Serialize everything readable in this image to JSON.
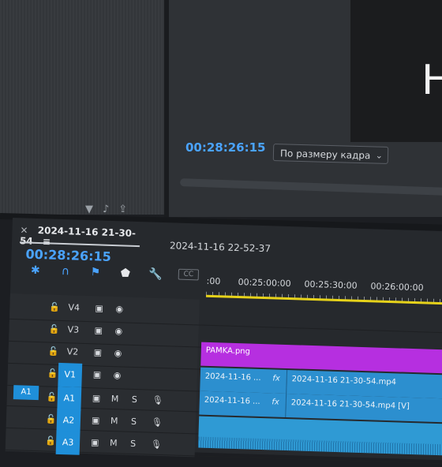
{
  "source_panel": {
    "icons": [
      "filter-icon",
      "music-icon",
      "export-icon"
    ]
  },
  "program": {
    "timecode": "00:28:26:15",
    "fit_dropdown": "По размеру кадра",
    "video_letter": "Н"
  },
  "timeline": {
    "tab_active": "2024-11-16 21-30-54",
    "tab_inactive": "2024-11-16 22-52-37",
    "timecode": "00:28:26:15",
    "ruler": [
      ":00",
      "00:25:00:00",
      "00:25:30:00",
      "00:26:00:00"
    ],
    "tools": [
      "snap-icon",
      "magnet-icon",
      "marker-icon",
      "marker-add-icon",
      "wrench-icon",
      "captions-icon"
    ],
    "tracks": {
      "v4": "V4",
      "v3": "V3",
      "v2": "V2",
      "v1": "V1",
      "a1_src": "A1",
      "a1": "A1",
      "a2": "A2",
      "a3": "A3",
      "mute": "M",
      "solo": "S"
    },
    "clips": {
      "ramka": "PAMKA.png",
      "v2_left": "2024-11-16 ...",
      "v2_right": "2024-11-16 21-30-54.mp4",
      "v1_left": "2024-11-16 ...",
      "v1_right": "2024-11-16 21-30-54.mp4 [V]",
      "fx": "fx"
    }
  },
  "colors": {
    "accent": "#4aa3ff",
    "clip_video": "#2c8fcf",
    "clip_graphic": "#b62fe0",
    "work_area": "#e6d21a"
  }
}
